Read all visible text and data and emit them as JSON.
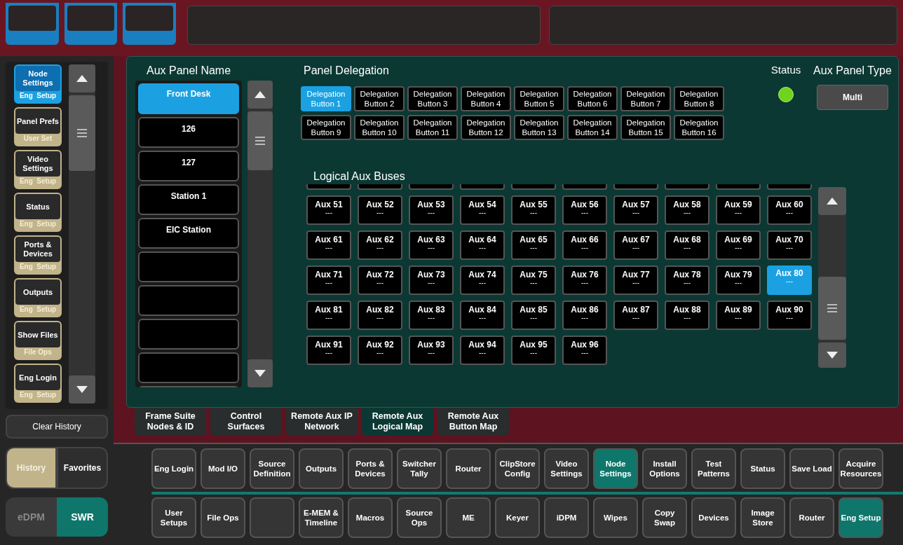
{
  "history": {
    "items": [
      {
        "title": "Node Settings",
        "category": "Eng  Setup",
        "selected": true
      },
      {
        "title": "Panel Prefs",
        "category": "User Set",
        "selected": false
      },
      {
        "title": "Video Settings",
        "category": "Eng  Setup",
        "selected": false
      },
      {
        "title": "Status",
        "category": "Eng  Setup",
        "selected": false
      },
      {
        "title": "Ports & Devices",
        "category": "Eng  Setup",
        "selected": false
      },
      {
        "title": "Outputs",
        "category": "Eng  Setup",
        "selected": false
      },
      {
        "title": "Show Files",
        "category": "File Ops",
        "selected": false
      },
      {
        "title": "Eng Login",
        "category": "Eng  Setup",
        "selected": false
      }
    ],
    "clear_button": "Clear History",
    "view_tabs": [
      {
        "label": "History",
        "selected": true
      },
      {
        "label": "Favorites",
        "selected": false
      }
    ]
  },
  "mode_tabs": [
    {
      "label": "eDPM",
      "selected": false
    },
    {
      "label": "SWR",
      "selected": true
    }
  ],
  "aux_panel_name": {
    "title": "Aux Panel Name",
    "items": [
      {
        "label": "Front Desk",
        "selected": true
      },
      {
        "label": "126",
        "selected": false
      },
      {
        "label": "127",
        "selected": false
      },
      {
        "label": "Station 1",
        "selected": false
      },
      {
        "label": "EIC Station",
        "selected": false
      }
    ]
  },
  "panel_delegation": {
    "title": "Panel Delegation",
    "buttons": [
      {
        "label": "Delegation Button 1",
        "selected": true
      },
      {
        "label": "Delegation Button 2",
        "selected": false
      },
      {
        "label": "Delegation Button 3",
        "selected": false
      },
      {
        "label": "Delegation Button 4",
        "selected": false
      },
      {
        "label": "Delegation Button 5",
        "selected": false
      },
      {
        "label": "Delegation Button 6",
        "selected": false
      },
      {
        "label": "Delegation Button 7",
        "selected": false
      },
      {
        "label": "Delegation Button 8",
        "selected": false
      },
      {
        "label": "Delegation Button 9",
        "selected": false
      },
      {
        "label": "Delegation Button 10",
        "selected": false
      },
      {
        "label": "Delegation Button 11",
        "selected": false
      },
      {
        "label": "Delegation Button 12",
        "selected": false
      },
      {
        "label": "Delegation Button 13",
        "selected": false
      },
      {
        "label": "Delegation Button 14",
        "selected": false
      },
      {
        "label": "Delegation Button 15",
        "selected": false
      },
      {
        "label": "Delegation Button 16",
        "selected": false
      }
    ]
  },
  "status": {
    "label": "Status",
    "on": true
  },
  "aux_panel_type": {
    "label": "Aux Panel Type",
    "value": "Multi"
  },
  "logical_aux_buses": {
    "title": "Logical Aux Buses",
    "buses": [
      {
        "name": "Aux 51",
        "source": "---",
        "selected": false
      },
      {
        "name": "Aux 52",
        "source": "---",
        "selected": false
      },
      {
        "name": "Aux 53",
        "source": "---",
        "selected": false
      },
      {
        "name": "Aux 54",
        "source": "---",
        "selected": false
      },
      {
        "name": "Aux 55",
        "source": "---",
        "selected": false
      },
      {
        "name": "Aux 56",
        "source": "---",
        "selected": false
      },
      {
        "name": "Aux 57",
        "source": "---",
        "selected": false
      },
      {
        "name": "Aux 58",
        "source": "---",
        "selected": false
      },
      {
        "name": "Aux 59",
        "source": "---",
        "selected": false
      },
      {
        "name": "Aux 60",
        "source": "---",
        "selected": false
      },
      {
        "name": "Aux 61",
        "source": "---",
        "selected": false
      },
      {
        "name": "Aux 62",
        "source": "---",
        "selected": false
      },
      {
        "name": "Aux 63",
        "source": "---",
        "selected": false
      },
      {
        "name": "Aux 64",
        "source": "---",
        "selected": false
      },
      {
        "name": "Aux 65",
        "source": "---",
        "selected": false
      },
      {
        "name": "Aux 66",
        "source": "---",
        "selected": false
      },
      {
        "name": "Aux 67",
        "source": "---",
        "selected": false
      },
      {
        "name": "Aux 68",
        "source": "---",
        "selected": false
      },
      {
        "name": "Aux 69",
        "source": "---",
        "selected": false
      },
      {
        "name": "Aux 70",
        "source": "---",
        "selected": false
      },
      {
        "name": "Aux 71",
        "source": "---",
        "selected": false
      },
      {
        "name": "Aux 72",
        "source": "---",
        "selected": false
      },
      {
        "name": "Aux 73",
        "source": "---",
        "selected": false
      },
      {
        "name": "Aux 74",
        "source": "---",
        "selected": false
      },
      {
        "name": "Aux 75",
        "source": "---",
        "selected": false
      },
      {
        "name": "Aux 76",
        "source": "---",
        "selected": false
      },
      {
        "name": "Aux 77",
        "source": "---",
        "selected": false
      },
      {
        "name": "Aux 78",
        "source": "---",
        "selected": false
      },
      {
        "name": "Aux 79",
        "source": "---",
        "selected": false
      },
      {
        "name": "Aux 80",
        "source": "---",
        "selected": true
      },
      {
        "name": "Aux 81",
        "source": "---",
        "selected": false
      },
      {
        "name": "Aux 82",
        "source": "---",
        "selected": false
      },
      {
        "name": "Aux 83",
        "source": "---",
        "selected": false
      },
      {
        "name": "Aux 84",
        "source": "---",
        "selected": false
      },
      {
        "name": "Aux 85",
        "source": "---",
        "selected": false
      },
      {
        "name": "Aux 86",
        "source": "---",
        "selected": false
      },
      {
        "name": "Aux 87",
        "source": "---",
        "selected": false
      },
      {
        "name": "Aux 88",
        "source": "---",
        "selected": false
      },
      {
        "name": "Aux 89",
        "source": "---",
        "selected": false
      },
      {
        "name": "Aux 90",
        "source": "---",
        "selected": false
      },
      {
        "name": "Aux 91",
        "source": "---",
        "selected": false
      },
      {
        "name": "Aux 92",
        "source": "---",
        "selected": false
      },
      {
        "name": "Aux 93",
        "source": "---",
        "selected": false
      },
      {
        "name": "Aux 94",
        "source": "---",
        "selected": false
      },
      {
        "name": "Aux 95",
        "source": "---",
        "selected": false
      },
      {
        "name": "Aux 96",
        "source": "---",
        "selected": false
      }
    ]
  },
  "sub_tabs": [
    {
      "label": "Frame Suite Nodes & ID",
      "selected": false
    },
    {
      "label": "Control Surfaces",
      "selected": false
    },
    {
      "label": "Remote Aux IP Network",
      "selected": false
    },
    {
      "label": "Remote Aux Logical Map",
      "selected": true
    },
    {
      "label": "Remote Aux Button Map",
      "selected": false
    }
  ],
  "menu_rows": [
    [
      {
        "label": "Eng Login",
        "selected": false
      },
      {
        "label": "Mod I/O",
        "selected": false
      },
      {
        "label": "Source Definition",
        "selected": false
      },
      {
        "label": "Outputs",
        "selected": false
      },
      {
        "label": "Ports & Devices",
        "selected": false
      },
      {
        "label": "Switcher Tally",
        "selected": false
      },
      {
        "label": "Router",
        "selected": false
      },
      {
        "label": "ClipStore Config",
        "selected": false
      },
      {
        "label": "Video Settings",
        "selected": false
      },
      {
        "label": "Node Settings",
        "selected": true
      },
      {
        "label": "Install Options",
        "selected": false
      },
      {
        "label": "Test Patterns",
        "selected": false
      },
      {
        "label": "Status",
        "selected": false
      },
      {
        "label": "Save Load",
        "selected": false
      },
      {
        "label": "Acquire Resources",
        "selected": false
      }
    ],
    [
      {
        "label": "User Setups",
        "selected": false
      },
      {
        "label": "File Ops",
        "selected": false
      },
      {
        "selected": false
      },
      {
        "label": "E-MEM & Timeline",
        "selected": false
      },
      {
        "label": "Macros",
        "selected": false
      },
      {
        "label": "Source Ops",
        "selected": false
      },
      {
        "label": "ME",
        "selected": false
      },
      {
        "label": "Keyer",
        "selected": false
      },
      {
        "label": "iDPM",
        "selected": false
      },
      {
        "label": "Wipes",
        "selected": false
      },
      {
        "label": "Copy Swap",
        "selected": false
      },
      {
        "label": "Devices",
        "selected": false
      },
      {
        "label": "Image Store",
        "selected": false
      },
      {
        "label": "Router",
        "selected": false
      },
      {
        "label": "Eng Setup",
        "selected": true
      }
    ]
  ]
}
